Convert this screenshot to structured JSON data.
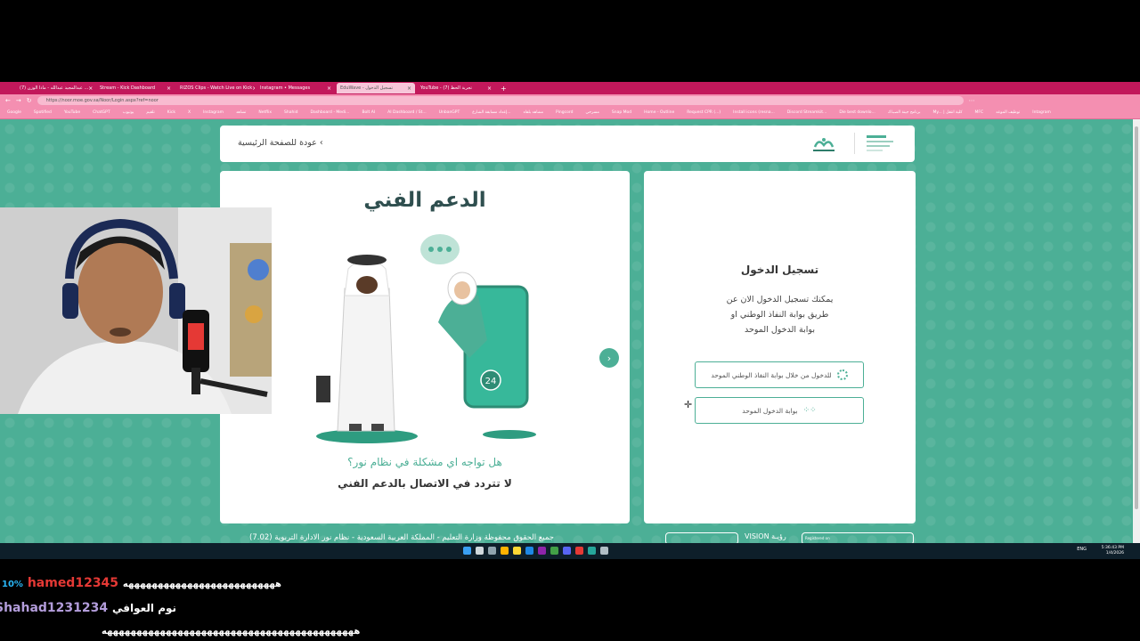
{
  "browser": {
    "tabs": [
      {
        "label": "(7) عبدالمجيد عبدالله - ماذا الوزن ...",
        "active": false
      },
      {
        "label": "Stream - Kick Dashboard",
        "active": false
      },
      {
        "label": "RIZOS Clips - Watch Live on Kick",
        "active": false
      },
      {
        "label": "Instagram • Messages",
        "active": false
      },
      {
        "label": "EduWave - تسجيل الدخول",
        "active": true
      },
      {
        "label": "YouTube - (7) تجربة الحظ",
        "active": false
      }
    ],
    "new_tab": "+",
    "url": "https://noor.moe.gov.sa/Noor/Login.aspx?ref=noor",
    "bookmarks": [
      "Google",
      "Spotified",
      "YouTube",
      "ChatGPT",
      "يوتيوب",
      "تلقيم",
      "Kick",
      "X",
      "Instagram",
      "تشاهد",
      "Netflix",
      "Shahid",
      "Dashboard - Medi...",
      "Bolt AI",
      "AI Dashboard / St...",
      "UnbanGPT",
      "إعداد مسابقة الشارع...",
      "مشاهد بلقاء",
      "Pingcord",
      "مسرحي",
      "Snap Mod",
      "Home - Outline",
      "Request CPR (...)",
      "Install icons (resna...",
      "Discord Streamkit...",
      "Die best downlo...",
      "برنامج جينة الصبـاك",
      "My... | كلية انتقل",
      "MFC",
      "توظيف الموعد",
      "Intagram"
    ]
  },
  "page": {
    "back_link": "عودة للصفحة الرئيسية ‹",
    "illustration": {
      "title": "الدعم الفني",
      "question": "هل تواجه اي مشكلة في نظام نور؟",
      "subtitle": "لا تتردد في الاتصال بالدعم الفني",
      "next_icon": "›",
      "phone_badge": "24"
    },
    "login": {
      "title": "تسجيل الدخول",
      "description_lines": [
        "يمكنك تسجيل الدخول الان عن",
        "طريق بوابة النفاذ الوطني او",
        "بوابة الدخول الموحد"
      ],
      "nafath_button": "للدخول من خلال بوابة النفاذ الوطني الموحد",
      "unified_button": "بوابة الدخول الموحد"
    },
    "footer": {
      "text": "جميع الحقوق محفوظة وزارة التعليم - المملكة العربية السعودية - نظام نور الادارة التربوية (7.02)",
      "vision": "VISION رؤيـة",
      "registered": "Registered on"
    }
  },
  "taskbar": {
    "tray": "ENG",
    "time": "5:36:43 PM",
    "date": "1/4/2026"
  },
  "chat": [
    {
      "badge": "10%",
      "user": "hamed12345",
      "message": "ههههههههههههههههههههههههههه",
      "color": "#e53935"
    },
    {
      "badge": "",
      "user": "Shahad1231234",
      "message": "نوم العوافي",
      "color": "#b39ddb"
    },
    {
      "badge": "",
      "user": "",
      "message": "هههههههههههههههههههههههههههههههههههههههههههه",
      "color": "#ffffff"
    }
  ],
  "colors": {
    "brand_green": "#4caf96",
    "browser_pink": "#c2185b"
  }
}
